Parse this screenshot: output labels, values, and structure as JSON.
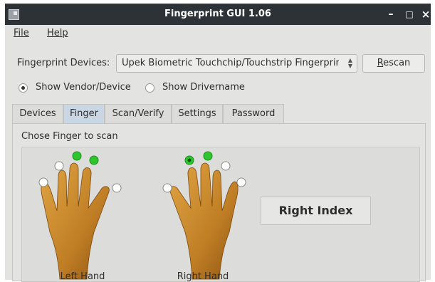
{
  "window": {
    "title": "Fingerprint GUI 1.06",
    "controls": [
      "–",
      "□",
      "×"
    ]
  },
  "menu": {
    "file": "File",
    "help": "Help"
  },
  "devices": {
    "label": "Fingerprint Devices:",
    "selected": "Upek Biometric Touchchip/Touchstrip Fingerprint Sensor",
    "rescan": "Rescan"
  },
  "display_mode": {
    "vendor": "Show Vendor/Device",
    "driver": "Show Drivername",
    "selected": "vendor"
  },
  "tabs": [
    "Devices",
    "Finger",
    "Scan/Verify",
    "Settings",
    "Password"
  ],
  "active_tab": "Finger",
  "finger_panel": {
    "prompt": "Chose Finger to scan",
    "left_hand": "Left Hand",
    "right_hand": "Right Hand",
    "selected_finger": "Right Index",
    "left_fingers_enrolled": [
      false,
      false,
      true,
      true,
      false
    ],
    "right_fingers_enrolled": [
      false,
      true,
      true,
      false,
      false
    ]
  },
  "colors": {
    "titlebar": "#2d3237",
    "enrolled": "#2ec52e",
    "active_tab": "#c9d6e3",
    "skin": "#c98a2c"
  }
}
